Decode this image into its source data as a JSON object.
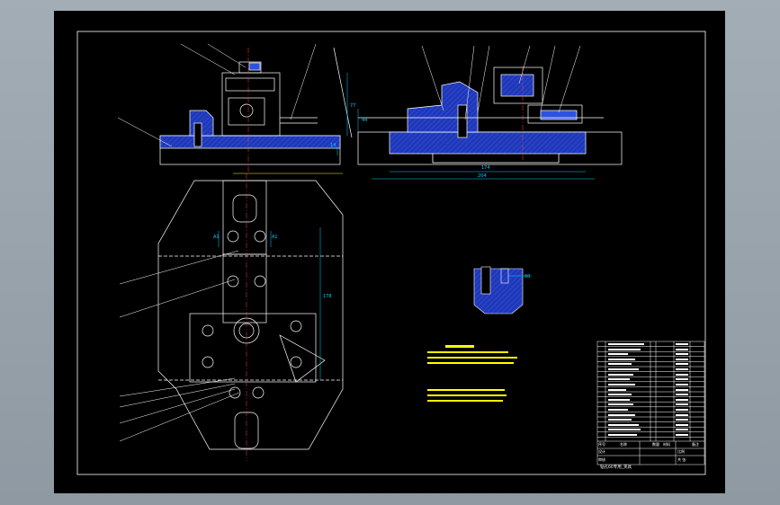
{
  "colors": {
    "background": "#000000",
    "linework": "#ffffff",
    "dimensions": "#00d0ff",
    "hatch": "#2840c8",
    "leaders": "#ffffff",
    "notes": "#ffff00"
  },
  "dimensions": {
    "left_height": "77",
    "left_pad": "14",
    "right_top": "44",
    "right_width": "174",
    "right_overall": "204",
    "plan_length": "178",
    "plan_a1": "A1",
    "plan_a2": "A1",
    "detail_dim": "60"
  },
  "title_block": {
    "figure_name": "钻孔60专用_夹具",
    "label_seq": "序号",
    "label_name": "名称",
    "label_qty": "数量",
    "label_material": "材料",
    "label_remark": "备注",
    "label_design": "设计",
    "label_check": "审核",
    "label_scale": "比例",
    "label_sheet": "共 张"
  }
}
